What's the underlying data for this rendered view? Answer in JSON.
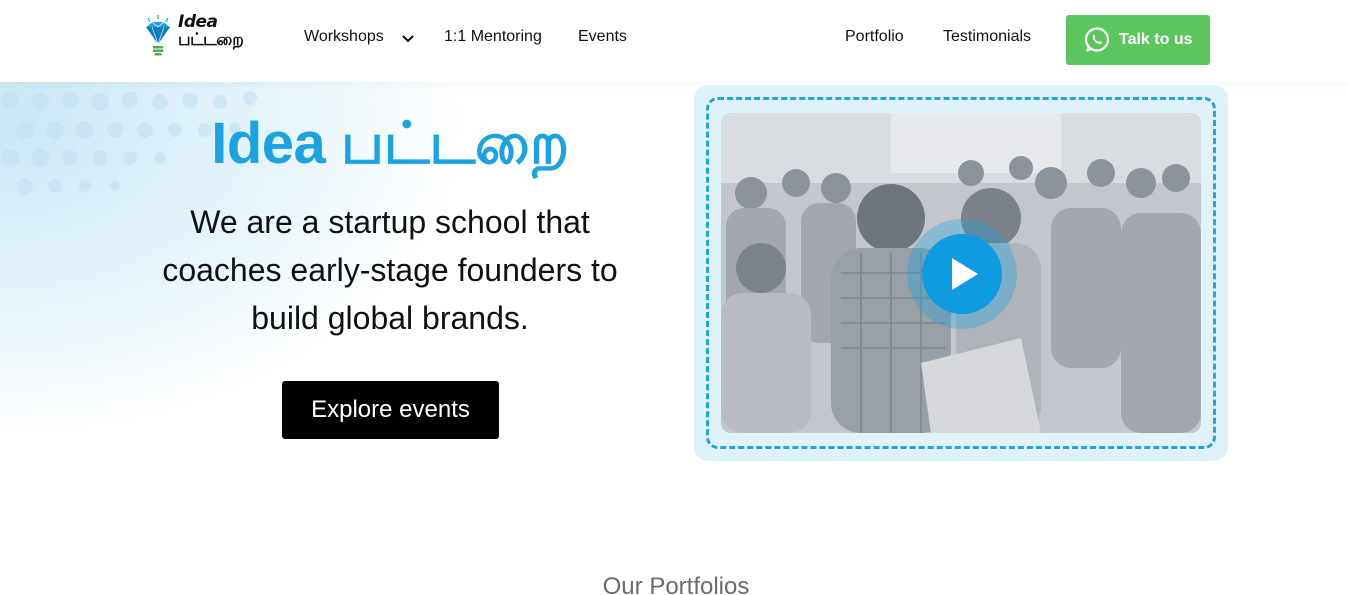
{
  "brand": {
    "logo_line1": "Idea",
    "logo_line2": "பட்டறை"
  },
  "nav": {
    "workshops": "Workshops",
    "mentoring": "1:1 Mentoring",
    "events": "Events",
    "portfolio": "Portfolio",
    "testimonials": "Testimonials"
  },
  "cta": {
    "talk_label": "Talk to us",
    "icon": "whatsapp-icon",
    "color": "#5cc65e"
  },
  "hero": {
    "title": "Idea பட்டறை",
    "subtitle": "We are a startup school that coaches early-stage founders to build global brands.",
    "explore_label": "Explore events",
    "title_color": "#1aa3e0"
  },
  "video": {
    "play_icon": "play-icon"
  },
  "portfolio_section": {
    "title": "Our Portfolios"
  }
}
